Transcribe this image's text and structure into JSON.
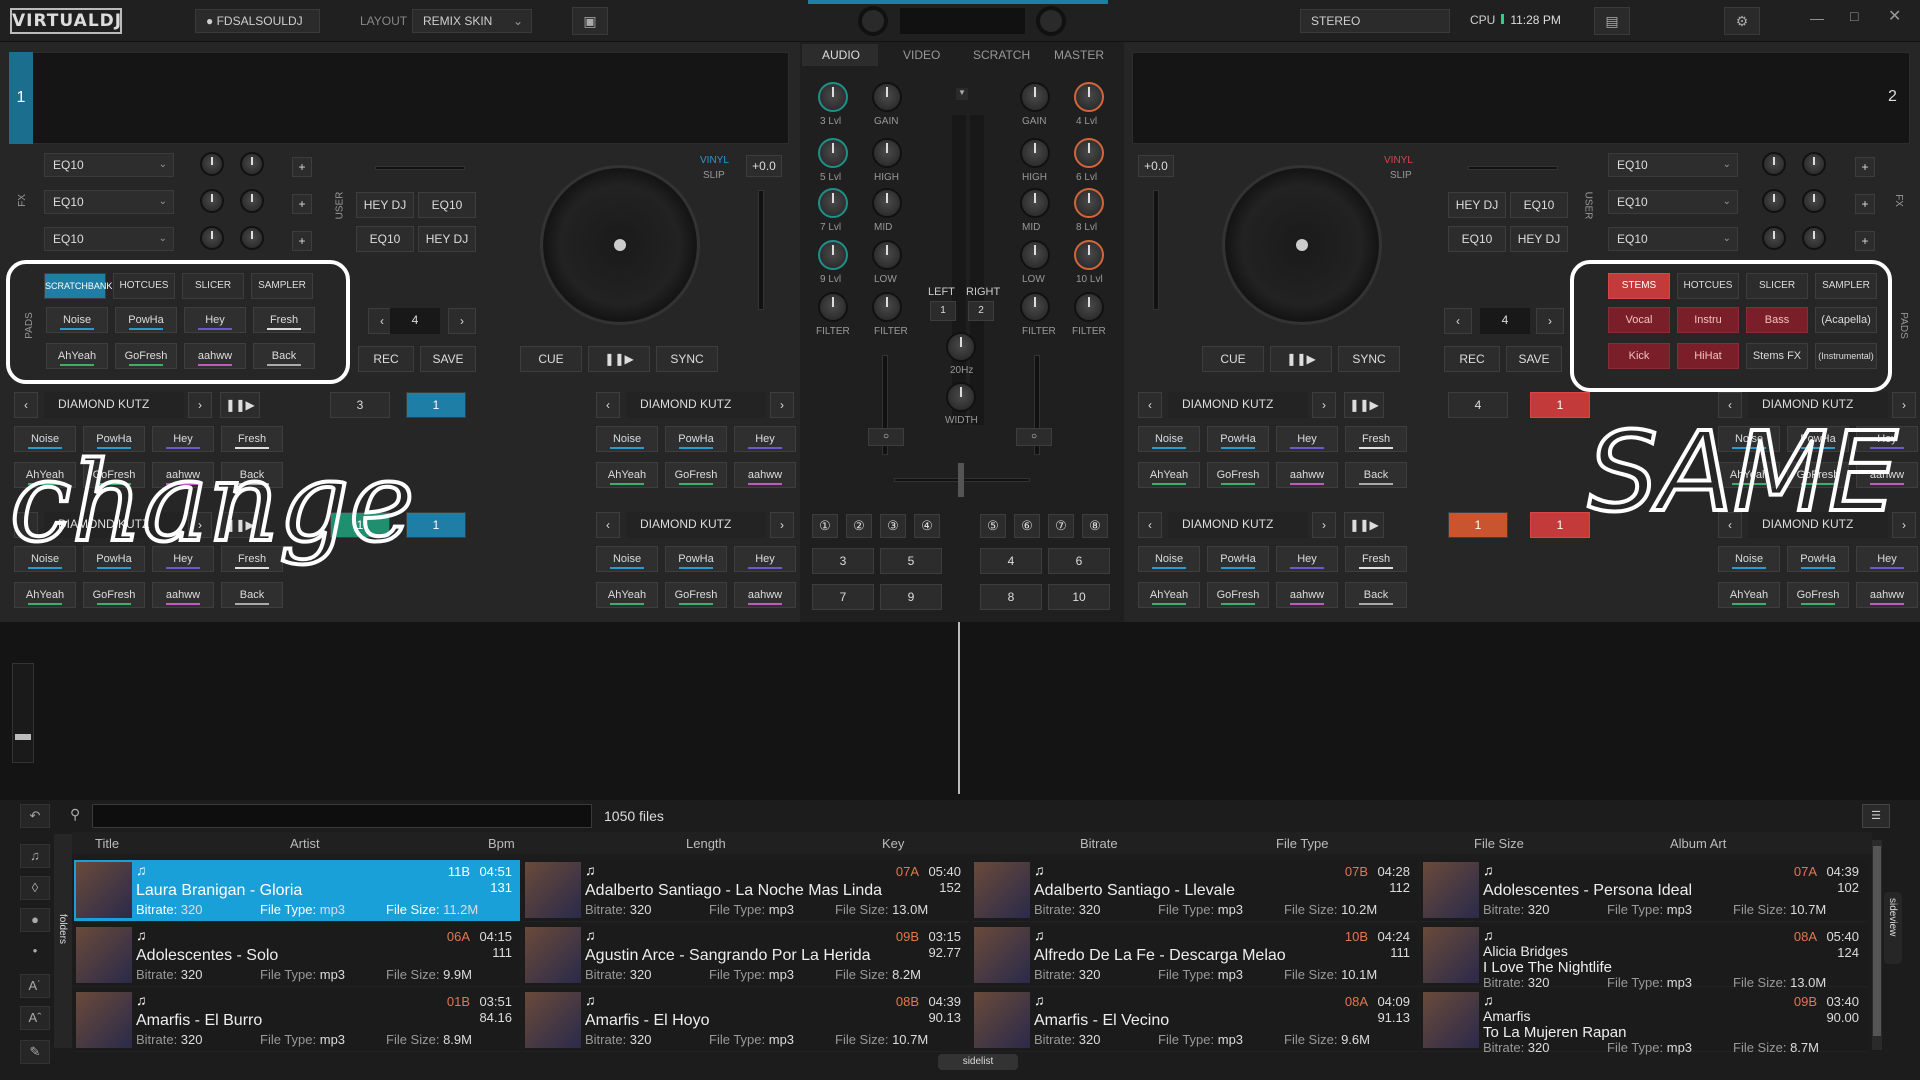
{
  "topbar": {
    "logo": "VIRTUALDJ",
    "user": "FDSALSOULDJ",
    "layout_label": "LAYOUT",
    "layout_value": "REMIX SKIN",
    "stereo": "STEREO",
    "cpu": "CPU",
    "time": "11:28 PM"
  },
  "mixer": {
    "tabs": [
      "AUDIO",
      "VIDEO",
      "SCRATCH",
      "MASTER"
    ],
    "left_knobs": [
      "3 Lvl",
      "5 Lvl",
      "7 Lvl",
      "9 Lvl",
      "FILTER"
    ],
    "right_knobs": [
      "4 Lvl",
      "6 Lvl",
      "8 Lvl",
      "10 Lvl",
      "FILTER"
    ],
    "eq": [
      "GAIN",
      "HIGH",
      "MID",
      "LOW",
      "FILTER"
    ],
    "left": "LEFT",
    "right": "RIGHT",
    "one": "1",
    "two": "2",
    "hz": "20Hz",
    "width": "WIDTH",
    "bottom_nums_left": [
      "3",
      "5",
      "7",
      "9"
    ],
    "bottom_nums_right": [
      "4",
      "6",
      "8",
      "10"
    ],
    "circle_nums": [
      "①",
      "②",
      "③",
      "④",
      "⑤",
      "⑥",
      "⑦",
      "⑧"
    ]
  },
  "deck_left": {
    "num": "1",
    "fx": "FX",
    "fx_slots": [
      "EQ10",
      "EQ10",
      "EQ10"
    ],
    "user": "USER",
    "user_btns": [
      "HEY DJ",
      "EQ10",
      "EQ10",
      "HEY DJ"
    ],
    "pads_label": "PADS",
    "pad_tabs": [
      "SCRATCHBANK",
      "HOTCUES",
      "SLICER",
      "SAMPLER"
    ],
    "pads": [
      "Noise",
      "PowHa",
      "Hey",
      "Fresh",
      "AhYeah",
      "GoFresh",
      "aahww",
      "Back"
    ],
    "vinyl": "VINYL",
    "slip": "SLIP",
    "pitch": "+0.0",
    "loop": "4",
    "rec": "REC",
    "save": "SAVE",
    "cue": "CUE",
    "play": "❚❚▶",
    "sync": "SYNC"
  },
  "deck_right": {
    "num": "2",
    "fx": "FX",
    "fx_slots": [
      "EQ10",
      "EQ10",
      "EQ10"
    ],
    "user": "USER",
    "user_btns": [
      "HEY DJ",
      "EQ10",
      "EQ10",
      "HEY DJ"
    ],
    "pads_label": "PADS",
    "pad_tabs": [
      "STEMS",
      "HOTCUES",
      "SLICER",
      "SAMPLER"
    ],
    "pads": [
      "Vocal",
      "Instru",
      "Bass",
      "(Acapella)",
      "Kick",
      "HiHat",
      "Stems FX",
      "(Instrumental)"
    ],
    "vinyl": "VINYL",
    "slip": "SLIP",
    "pitch": "+0.0",
    "loop": "4",
    "rec": "REC",
    "save": "SAVE",
    "cue": "CUE",
    "play": "❚❚▶",
    "sync": "SYNC"
  },
  "sampler_rows": {
    "name": "DIAMOND KUTZ",
    "play": "❚❚▶",
    "pads": [
      "Noise",
      "PowHa",
      "Hey",
      "Fresh",
      "AhYeah",
      "GoFresh",
      "aahww",
      "Back"
    ],
    "n1": "1",
    "n3": "3",
    "n4": "4"
  },
  "annotations": {
    "left": "change",
    "right": "SAME"
  },
  "browser": {
    "count": "1050 files",
    "sidebar_label": "folders",
    "sideview": "sideview",
    "sidelist": "sidelist",
    "columns": [
      "Title",
      "Artist",
      "Bpm",
      "Length",
      "Key",
      "Bitrate",
      "File Type",
      "File Size",
      "Album Art"
    ],
    "meta_labels": {
      "bitrate": "Bitrate:",
      "filetype": "File Type:",
      "filesize": "File Size:"
    },
    "tracks": [
      {
        "title": "Laura Branigan - Gloria",
        "key": "11B",
        "length": "04:51",
        "bpm": "131",
        "bitrate": "320",
        "type": "mp3",
        "size": "11.2M"
      },
      {
        "title": "Adalberto Santiago - La Noche Mas Linda",
        "key": "07A",
        "length": "05:40",
        "bpm": "152",
        "bitrate": "320",
        "type": "mp3",
        "size": "13.0M"
      },
      {
        "title": "Adalberto Santiago - Llevale",
        "key": "07B",
        "length": "04:28",
        "bpm": "112",
        "bitrate": "320",
        "type": "mp3",
        "size": "10.2M"
      },
      {
        "title": "Adolescentes - Persona Ideal",
        "key": "07A",
        "length": "04:39",
        "bpm": "102",
        "bitrate": "320",
        "type": "mp3",
        "size": "10.7M"
      },
      {
        "title": "Adolescentes - Solo",
        "key": "06A",
        "length": "04:15",
        "bpm": "111",
        "bitrate": "320",
        "type": "mp3",
        "size": "9.9M"
      },
      {
        "title": "Agustin Arce - Sangrando Por La Herida",
        "key": "09B",
        "length": "03:15",
        "bpm": "92.77",
        "bitrate": "320",
        "type": "mp3",
        "size": "8.2M"
      },
      {
        "title": "Alfredo De La Fe - Descarga Melao",
        "key": "10B",
        "length": "04:24",
        "bpm": "111",
        "bitrate": "320",
        "type": "mp3",
        "size": "10.1M"
      },
      {
        "title": "Alicia Bridges\nI Love The Nightlife",
        "title1": "Alicia Bridges",
        "title2": "I Love The Nightlife",
        "key": "08A",
        "length": "05:40",
        "bpm": "124",
        "bitrate": "320",
        "type": "mp3",
        "size": "13.0M"
      },
      {
        "title": "Amarfis - El Burro",
        "key": "01B",
        "length": "03:51",
        "bpm": "84.16",
        "bitrate": "320",
        "type": "mp3",
        "size": "8.9M"
      },
      {
        "title": "Amarfis - El Hoyo",
        "key": "08B",
        "length": "04:39",
        "bpm": "90.13",
        "bitrate": "320",
        "type": "mp3",
        "size": "10.7M"
      },
      {
        "title": "Amarfis - El Vecino",
        "key": "08A",
        "length": "04:09",
        "bpm": "91.13",
        "bitrate": "320",
        "type": "mp3",
        "size": "9.6M"
      },
      {
        "title": "Amarfis\nTo La Mujeren Rapan",
        "title1": "Amarfis",
        "title2": "To La Mujeren Rapan",
        "key": "09B",
        "length": "03:40",
        "bpm": "90.00",
        "bitrate": "320",
        "type": "mp3",
        "size": "8.7M"
      }
    ]
  }
}
